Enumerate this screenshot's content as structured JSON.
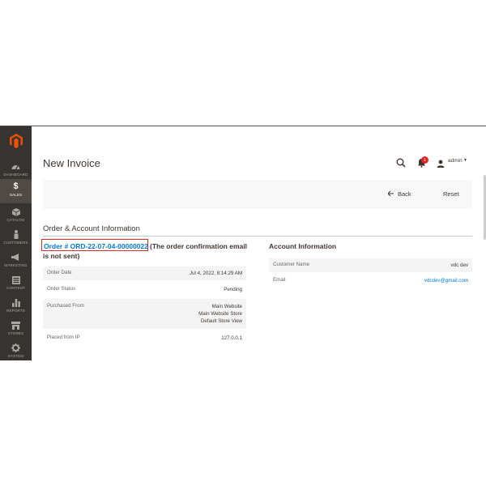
{
  "page": {
    "title": "New Invoice"
  },
  "header": {
    "user_name": "admin",
    "notification_count": "1"
  },
  "sidebar": {
    "items": [
      {
        "label": "DASHBOARD",
        "icon": "dashboard-icon"
      },
      {
        "label": "SALES",
        "icon": "dollar-icon"
      },
      {
        "label": "CATALOG",
        "icon": "box-icon"
      },
      {
        "label": "CUSTOMERS",
        "icon": "person-icon"
      },
      {
        "label": "MARKETING",
        "icon": "megaphone-icon"
      },
      {
        "label": "CONTENT",
        "icon": "content-icon"
      },
      {
        "label": "REPORTS",
        "icon": "bars-icon"
      },
      {
        "label": "STORES",
        "icon": "store-icon"
      },
      {
        "label": "SYSTEM",
        "icon": "gear-icon"
      }
    ]
  },
  "actions": {
    "back_label": "Back",
    "reset_label": "Reset"
  },
  "section": {
    "title": "Order & Account Information"
  },
  "order": {
    "link_text": "Order # ORD-22-07-04-00000022",
    "note_line1": "(The order confirmation email",
    "note_line2": "is not sent)",
    "fields": [
      {
        "label": "Order Date",
        "value": "Jul 4, 2022, 8:14:29 AM"
      },
      {
        "label": "Order Status",
        "value": "Pending"
      },
      {
        "label": "Purchased From",
        "value_lines": [
          "Main Website",
          "Main Website Store",
          "Default Store View"
        ]
      },
      {
        "label": "Placed from IP",
        "value": "127.0.0.1"
      }
    ]
  },
  "account": {
    "title": "Account Information",
    "customer_name_label": "Customer Name",
    "customer_name": "vdc dev",
    "email_label": "Email",
    "email": "vdcdev@gmail.com"
  },
  "colors": {
    "accent": "#007bdb",
    "sidebar": "#373330",
    "highlight": "#e02b27",
    "brand": "#eb5202"
  }
}
